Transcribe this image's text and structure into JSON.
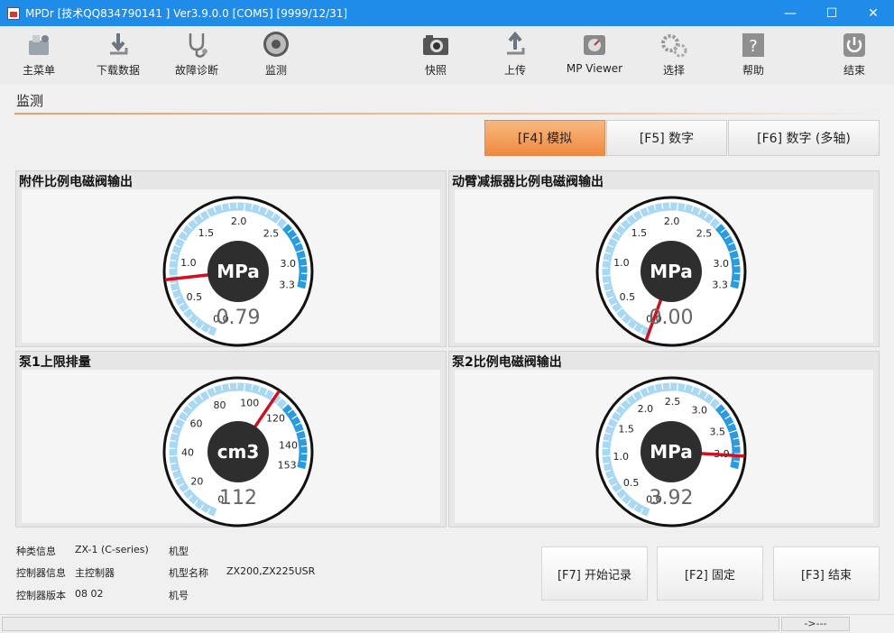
{
  "window": {
    "title": "MPDr [技术QQ834790141 ] Ver3.9.0.0 [COM5] [9999/12/31]"
  },
  "toolbar": {
    "items": [
      {
        "label": "主菜单",
        "icon": "main-menu-icon"
      },
      {
        "label": "下载数据",
        "icon": "download-icon"
      },
      {
        "label": "故障诊断",
        "icon": "stethoscope-icon"
      },
      {
        "label": "监测",
        "icon": "monitor-dial-icon"
      },
      {
        "label": "快照",
        "icon": "camera-icon"
      },
      {
        "label": "上传",
        "icon": "upload-icon"
      },
      {
        "label": "MP Viewer",
        "icon": "mp-viewer-icon"
      },
      {
        "label": "选择",
        "icon": "gears-icon"
      },
      {
        "label": "帮助",
        "icon": "help-icon"
      },
      {
        "label": "结束",
        "icon": "power-icon"
      }
    ]
  },
  "section": {
    "title": "监测"
  },
  "tabs": [
    {
      "label": "[F4] 模拟",
      "active": true
    },
    {
      "label": "[F5] 数字",
      "active": false
    },
    {
      "label": "[F6] 数字 (多轴)",
      "active": false
    }
  ],
  "gauges": [
    {
      "title": "附件比例电磁阀输出",
      "unit": "MPa",
      "value_text": "0.79",
      "value": 0.79,
      "min": 0,
      "max": 3.3,
      "ticks": [
        "0.0",
        "0.5",
        "1.0",
        "1.5",
        "2.0",
        "2.5",
        "3.0",
        "3.3"
      ]
    },
    {
      "title": "动臂减振器比例电磁阀输出",
      "unit": "MPa",
      "value_text": "0.00",
      "value": 0.0,
      "min": 0,
      "max": 3.3,
      "ticks": [
        "0.0",
        "0.5",
        "1.0",
        "1.5",
        "2.0",
        "2.5",
        "3.0",
        "3.3"
      ]
    },
    {
      "title": "泵1上限排量",
      "unit": "cm3",
      "value_text": "112",
      "value": 112,
      "min": 0,
      "max": 153,
      "ticks": [
        "0",
        "20",
        "40",
        "60",
        "80",
        "100",
        "120",
        "140",
        "153"
      ]
    },
    {
      "title": "泵2比例电磁阀输出",
      "unit": "MPa",
      "value_text": "3.92",
      "value": 3.92,
      "min": 0,
      "max": 4.1,
      "ticks": [
        "0.0",
        "0.5",
        "1.0",
        "1.5",
        "2.0",
        "2.5",
        "3.0",
        "3.5",
        "3.9"
      ]
    }
  ],
  "info": {
    "type_label": "种类信息",
    "type_value": "ZX-1 (C-series)",
    "controller_label": "控制器信息",
    "controller_value": "主控制器",
    "version_label": "控制器版本",
    "version_value": "08 02",
    "model_label": "机型",
    "model_name_label": "机型名称",
    "model_name_value": "ZX200,ZX225USR",
    "machine_no_label": "机号"
  },
  "buttons": {
    "start_record": "[F7] 开始记录",
    "fix": "[F2] 固定",
    "end": "[F3] 结束"
  },
  "status": {
    "right": "->---"
  },
  "colors": {
    "accent": "#1e8ce8",
    "arc_light": "#a8d8f4",
    "arc_dark": "#2a9be0",
    "needle": "#d01020",
    "tab_active": "#f0a060"
  }
}
